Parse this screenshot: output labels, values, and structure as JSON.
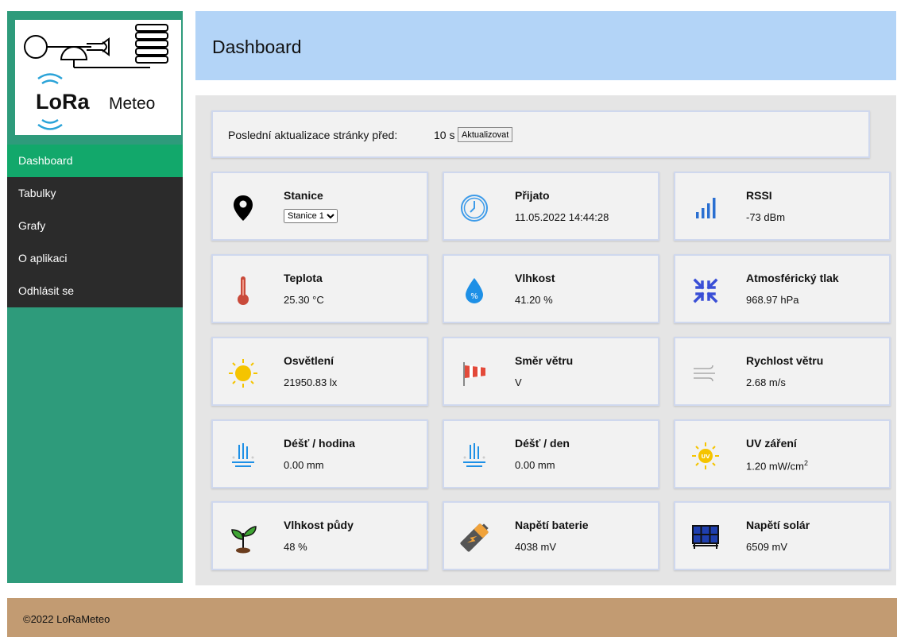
{
  "logo": {
    "brand": "LoRa",
    "suffix": "Meteo"
  },
  "nav": [
    {
      "label": "Dashboard",
      "active": true
    },
    {
      "label": "Tabulky"
    },
    {
      "label": "Grafy"
    },
    {
      "label": "O aplikaci"
    },
    {
      "label": "Odhlásit se"
    }
  ],
  "header": {
    "title": "Dashboard"
  },
  "update_bar": {
    "text": "Poslední aktualizace stránky před:",
    "value": "10 s",
    "button": "Aktualizovat"
  },
  "cards": {
    "stanice": {
      "label": "Stanice",
      "selected": "Stanice 1"
    },
    "prijato": {
      "label": "Přijato",
      "value": "11.05.2022 14:44:28"
    },
    "rssi": {
      "label": "RSSI",
      "value": "-73 dBm"
    },
    "teplota": {
      "label": "Teplota",
      "value": "25.30 °C"
    },
    "vlhkost": {
      "label": "Vlhkost",
      "value": "41.20 %"
    },
    "tlak": {
      "label": "Atmosférický tlak",
      "value": "968.97 hPa"
    },
    "osvetleni": {
      "label": "Osvětlení",
      "value": "21950.83 lx"
    },
    "smer": {
      "label": "Směr větru",
      "value": "V"
    },
    "rychlost": {
      "label": "Rychlost větru",
      "value": "2.68 m/s"
    },
    "dest_hodina": {
      "label": "Déšť / hodina",
      "value": "0.00 mm"
    },
    "dest_den": {
      "label": "Déšť / den",
      "value": "0.00 mm"
    },
    "uv": {
      "label": "UV záření",
      "value": "1.20 mW/cm",
      "unit_sup": "2"
    },
    "vlhkost_pudy": {
      "label": "Vlhkost půdy",
      "value": "48 %"
    },
    "baterie": {
      "label": "Napětí baterie",
      "value": "4038 mV"
    },
    "solar": {
      "label": "Napětí solár",
      "value": "6509 mV"
    }
  },
  "footer": {
    "text": "©2022 LoRaMeteo"
  },
  "colors": {
    "sidebar": "#2e9b7b",
    "nav_bg": "#2b2b2b",
    "nav_active": "#12a86b",
    "header": "#b3d4f7",
    "footer": "#c29b72"
  }
}
